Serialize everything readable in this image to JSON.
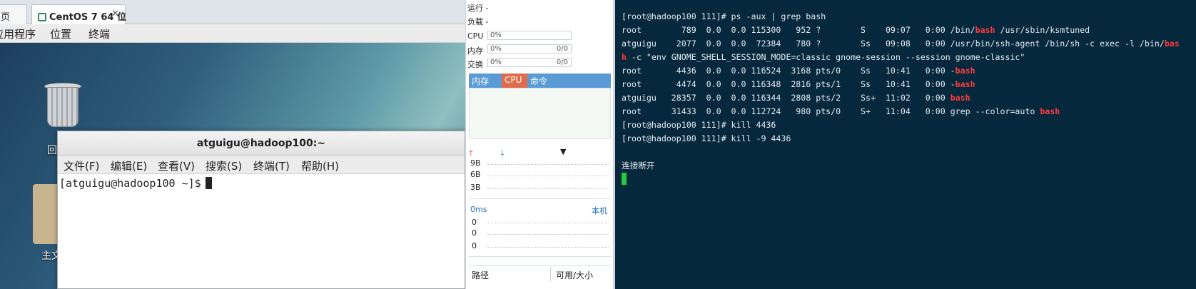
{
  "vm": {
    "tabs": [
      {
        "label": "页"
      },
      {
        "label": "CentOS 7 64 位",
        "close": "✕"
      }
    ],
    "gnome_menu": [
      "应用程序",
      "位置",
      "终端"
    ],
    "desktop_icons": [
      {
        "label": "回"
      },
      {
        "label": "主文"
      }
    ],
    "terminal": {
      "title": "atguigu@hadoop100:~",
      "menu": [
        "文件(F)",
        "编辑(E)",
        "查看(V)",
        "搜索(S)",
        "终端(T)",
        "帮助(H)"
      ],
      "prompt": "[atguigu@hadoop100 ~]$"
    }
  },
  "monitor": {
    "running_label": "运行 -",
    "load_label": "负载 -",
    "cpu": {
      "label": "CPU",
      "value": "0%"
    },
    "mem": {
      "label": "内存",
      "value": "0%",
      "extra": "0/0"
    },
    "swap": {
      "label": "交换",
      "value": "0%",
      "extra": "0/0"
    },
    "proc_tabs": [
      "内存",
      "CPU",
      "命令"
    ],
    "net_ticks": [
      "9B",
      "6B",
      "3B"
    ],
    "latency_label": "0ms",
    "local_label": "本机",
    "latency_ticks": [
      "0",
      "0",
      "0"
    ],
    "disk_cols": [
      "路径",
      "可用/大小"
    ]
  },
  "ssh": {
    "lines": [
      [
        {
          "t": "[root@hadoop100 111]# ps -aux | grep bash"
        }
      ],
      [
        {
          "t": "root        789  0.0  0.0 115300   952 ?        S    09:07   0:00 /bin/"
        },
        {
          "t": "bash",
          "red": true
        },
        {
          "t": " /usr/sbin/ksmtuned"
        }
      ],
      [
        {
          "t": "atguigu    2077  0.0  0.0  72384   780 ?        Ss   09:08   0:00 /usr/bin/ssh-agent /bin/sh -c exec -l /bin/"
        },
        {
          "t": "bas",
          "red": true
        }
      ],
      [
        {
          "t": "h",
          "red": true
        },
        {
          "t": " -c \"env GNOME_SHELL_SESSION_MODE=classic gnome-session --session gnome-classic\""
        }
      ],
      [
        {
          "t": "root       4436  0.0  0.0 116524  3168 pts/0    Ss   10:41   0:00 -"
        },
        {
          "t": "bash",
          "red": true
        }
      ],
      [
        {
          "t": "root       4474  0.0  0.0 116348  2816 pts/1    Ss   10:41   0:00 -"
        },
        {
          "t": "bash",
          "red": true
        }
      ],
      [
        {
          "t": "atguigu   28357  0.0  0.0 116344  2808 pts/2    Ss+  11:02   0:00 "
        },
        {
          "t": "bash",
          "red": true
        }
      ],
      [
        {
          "t": "root      31433  0.0  0.0 112724   980 pts/0    S+   11:04   0:00 grep --color=auto "
        },
        {
          "t": "bash",
          "red": true
        }
      ],
      [
        {
          "t": "[root@hadoop100 111]# kill 4436"
        }
      ],
      [
        {
          "t": "[root@hadoop100 111]# kill -9 4436"
        }
      ],
      [
        {
          "t": ""
        }
      ],
      [
        {
          "t": "连接断开"
        }
      ]
    ]
  }
}
